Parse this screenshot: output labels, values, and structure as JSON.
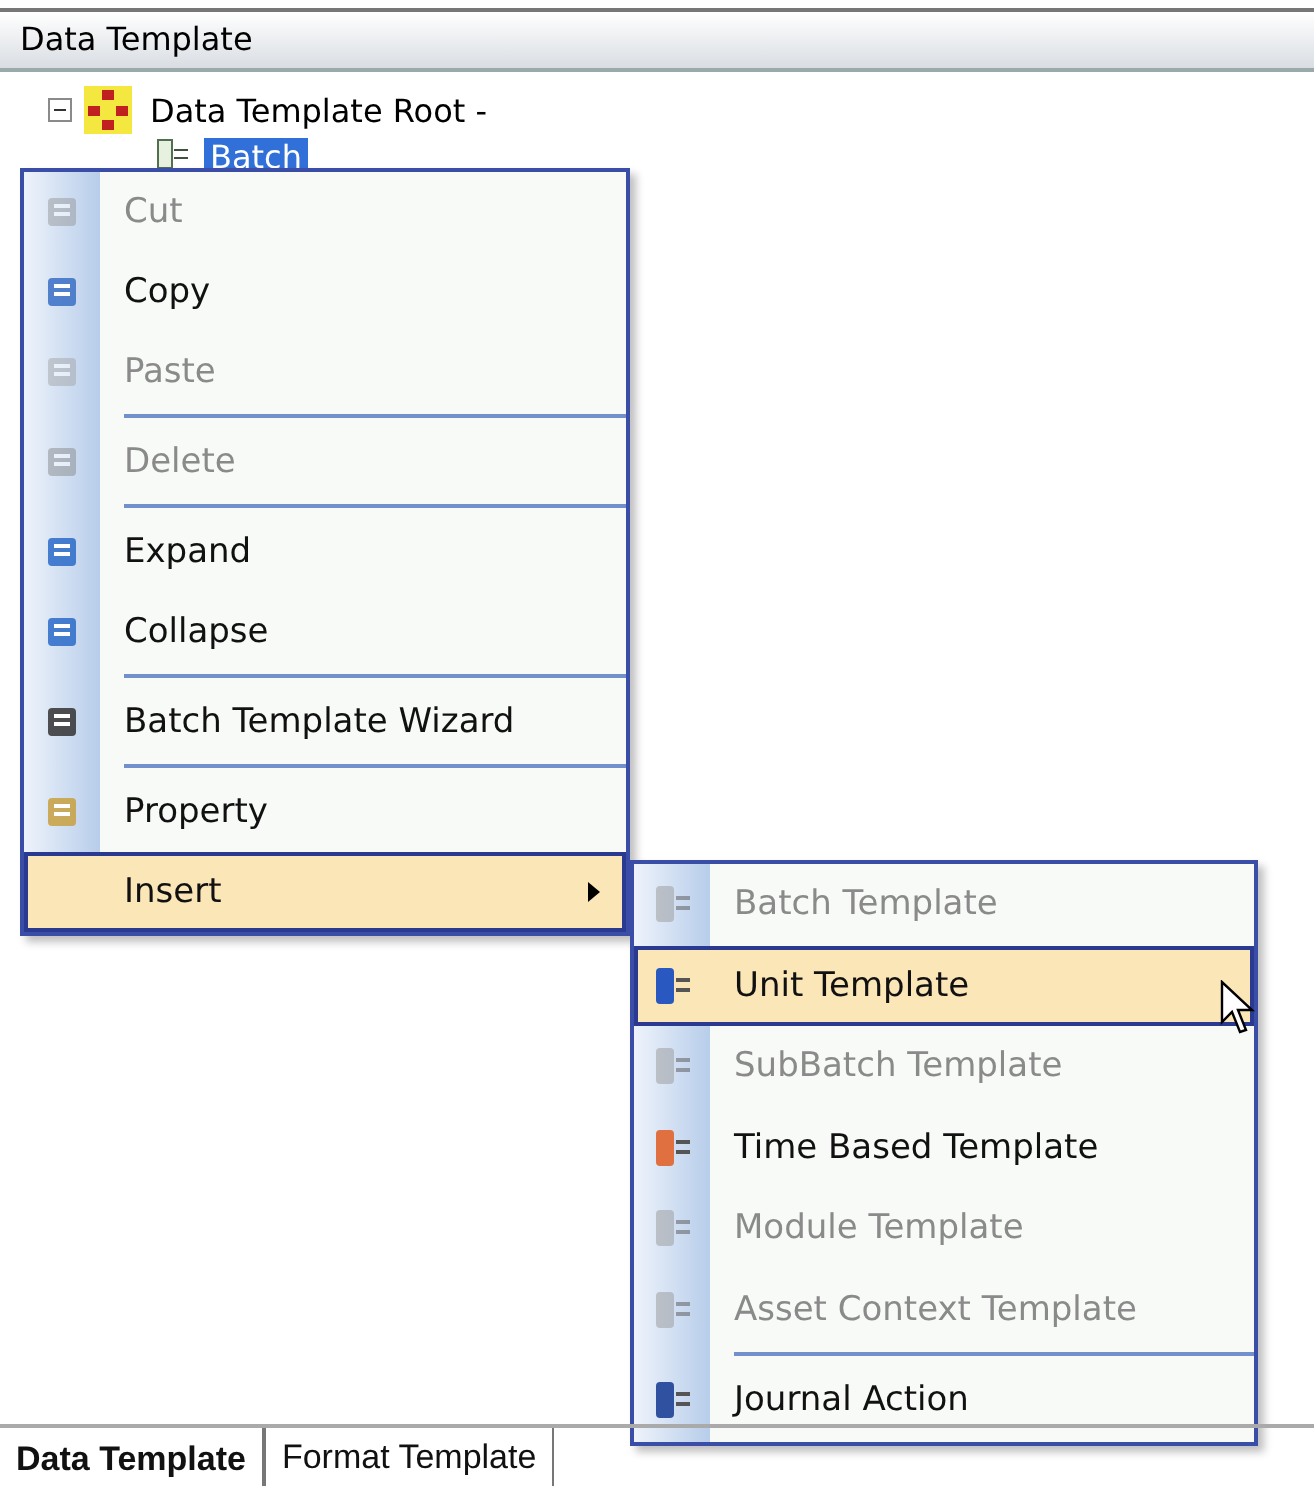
{
  "panel": {
    "title": "Data Template"
  },
  "tree": [
    {
      "label": "Data Template Root -",
      "expanded": true,
      "selected": false,
      "children": [
        {
          "label": "Batch",
          "selected": true
        }
      ]
    }
  ],
  "context_menu": [
    {
      "kind": "item",
      "label": "Cut",
      "disabled": true,
      "selected": false,
      "submenu": false
    },
    {
      "kind": "item",
      "label": "Copy",
      "disabled": false,
      "selected": false,
      "submenu": false
    },
    {
      "kind": "item",
      "label": "Paste",
      "disabled": true,
      "selected": false,
      "submenu": false
    },
    {
      "kind": "separator"
    },
    {
      "kind": "item",
      "label": "Delete",
      "disabled": true,
      "selected": false,
      "submenu": false
    },
    {
      "kind": "separator"
    },
    {
      "kind": "item",
      "label": "Expand",
      "disabled": false,
      "selected": false,
      "submenu": false
    },
    {
      "kind": "item",
      "label": "Collapse",
      "disabled": false,
      "selected": false,
      "submenu": false
    },
    {
      "kind": "separator"
    },
    {
      "kind": "item",
      "label": "Batch Template Wizard",
      "disabled": false,
      "selected": false,
      "submenu": false
    },
    {
      "kind": "separator"
    },
    {
      "kind": "item",
      "label": "Property",
      "disabled": false,
      "selected": false,
      "submenu": false
    },
    {
      "kind": "item",
      "label": "Insert",
      "disabled": false,
      "selected": true,
      "submenu": true
    }
  ],
  "submenu": [
    {
      "kind": "item",
      "label": "Batch Template",
      "disabled": true,
      "selected": false
    },
    {
      "kind": "item",
      "label": "Unit Template",
      "disabled": false,
      "selected": true
    },
    {
      "kind": "item",
      "label": "SubBatch Template",
      "disabled": true,
      "selected": false
    },
    {
      "kind": "item",
      "label": "Time Based Template",
      "disabled": false,
      "selected": false
    },
    {
      "kind": "item",
      "label": "Module Template",
      "disabled": true,
      "selected": false
    },
    {
      "kind": "item",
      "label": "Asset Context Template",
      "disabled": true,
      "selected": false
    },
    {
      "kind": "separator"
    },
    {
      "kind": "item",
      "label": "Journal Action",
      "disabled": false,
      "selected": false
    }
  ],
  "tabs": [
    {
      "label": "Data Template",
      "selected": true
    },
    {
      "label": "Format Template",
      "selected": false
    }
  ]
}
